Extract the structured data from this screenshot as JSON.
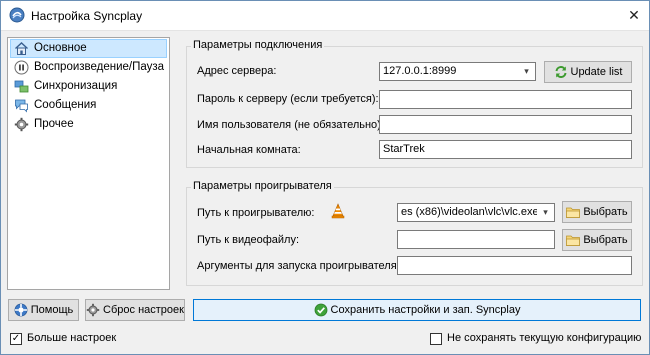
{
  "window": {
    "title": "Настройка Syncplay"
  },
  "sidebar": {
    "items": [
      {
        "label": "Основное",
        "selected": true
      },
      {
        "label": "Воспроизведение/Пауза",
        "selected": false
      },
      {
        "label": "Синхронизация",
        "selected": false
      },
      {
        "label": "Сообщения",
        "selected": false
      },
      {
        "label": "Прочее",
        "selected": false
      }
    ]
  },
  "connection": {
    "title": "Параметры подключения",
    "server_label": "Адрес сервера:",
    "server_value": "127.0.0.1:8999",
    "update_label": "Update list",
    "password_label": "Пароль к серверу (если требуется):",
    "password_value": "",
    "username_label": "Имя пользователя (не обязательно):",
    "username_value": "",
    "room_label": "Начальная комната:",
    "room_value": "StarTrek"
  },
  "player": {
    "title": "Параметры проигрывателя",
    "path_label": "Путь к проигрывателю:",
    "path_value": "es (x86)\\videolan\\vlc\\vlc.exe",
    "browse_label": "Выбрать",
    "video_label": "Путь к видеофайлу:",
    "video_value": "",
    "video_browse_label": "Выбрать",
    "args_label": "Аргументы для запуска проигрывателя:",
    "args_value": ""
  },
  "footer": {
    "help_label": "Помощь",
    "reset_label": "Сброс настроек",
    "save_label": "Сохранить настройки и зап. Syncplay",
    "more_label": "Больше настроек",
    "more_checked": true,
    "nosave_label": "Не сохранять текущую конфигурацию",
    "nosave_checked": false
  },
  "colors": {
    "accent": "#cde8ff",
    "border": "#6a8fb5",
    "save_border": "#0078d7"
  },
  "icons": [
    "syncplay-icon",
    "house-icon",
    "pause-icon",
    "sync-icon",
    "chat-icon",
    "gear-icon",
    "refresh-icon",
    "vlc-cone-icon",
    "folder-icon",
    "help-icon",
    "reset-icon",
    "checkmark-icon"
  ]
}
